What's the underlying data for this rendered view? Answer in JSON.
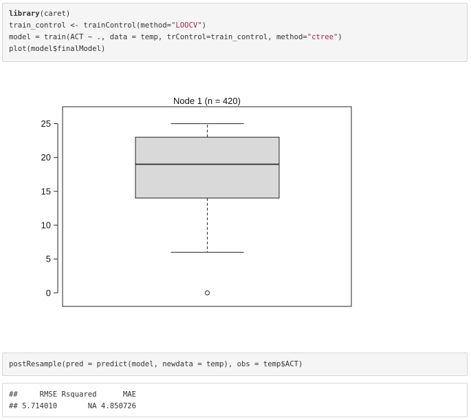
{
  "code_cell_1": {
    "line1": {
      "fn": "library",
      "rest": "(caret)"
    },
    "line2": {
      "pre": "train_control <- trainControl(method=",
      "str": "\"LOOCV\"",
      "post": ")"
    },
    "line3": {
      "pre": "model = train(ACT ~ ., data = temp, trControl=train_control, method=",
      "str": "\"ctree\"",
      "post": ")"
    },
    "line4": "plot(model$finalModel)"
  },
  "chart_data": {
    "type": "boxplot",
    "title": "Node 1 (n = 420)",
    "ylim": [
      -2,
      27.5
    ],
    "yticks": [
      "0",
      "5",
      "10",
      "15",
      "20",
      "25"
    ],
    "ytick_values": [
      0,
      5,
      10,
      15,
      20,
      25
    ],
    "box": {
      "whisker_low": 6,
      "q1": 14,
      "median": 19,
      "q3": 23,
      "whisker_high": 25
    },
    "outliers": [
      0
    ],
    "colors": {
      "box_fill": "#d9d9d9",
      "stroke": "#222222"
    }
  },
  "code_cell_2": {
    "line1": "postResample(pred = predict(model, newdata = temp), obs = temp$ACT)"
  },
  "output": {
    "line1": "##     RMSE Rsquared      MAE",
    "line2": "## 5.714010       NA 4.850726"
  }
}
